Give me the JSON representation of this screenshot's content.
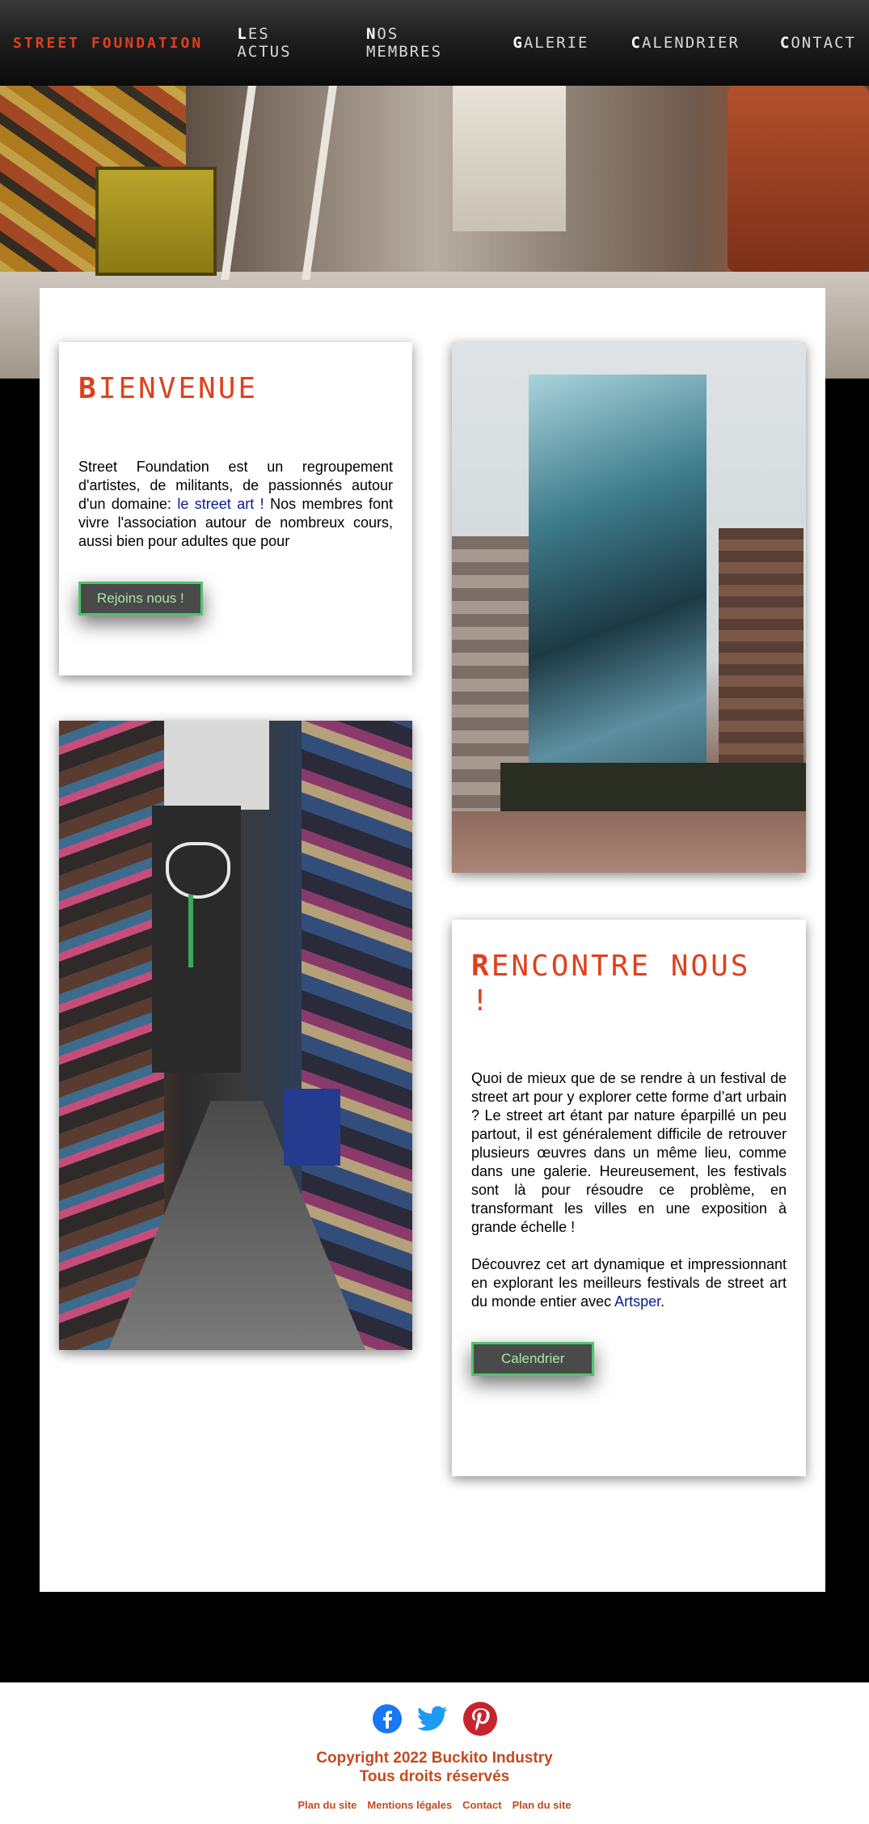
{
  "nav": {
    "brand": "STREET FOUNDATION",
    "links": [
      "LES ACTUS",
      "NOS MEMBRES",
      "GALERIE",
      "CALENDRIER",
      "CONTACT"
    ]
  },
  "welcome": {
    "title": "BIENVENUE",
    "text_before": "Street Foundation est un regroupement d'artistes, de militants, de passionnés autour d'un domaine: ",
    "link": "le street art !",
    "text_after": " Nos membres font vivre l'association autour de nombreux cours, aussi bien pour adultes que pour",
    "button": "Rejoins nous !"
  },
  "meet": {
    "title": "RENCONTRE NOUS !",
    "paragraph1": "Quoi de mieux que de se rendre à un festival de street art pour y explorer cette forme d’art urbain ? Le street art étant par nature éparpillé un peu partout, il est généralement difficile de retrouver plusieurs œuvres dans un même lieu, comme dans une galerie. Heureusement, les festivals sont là pour résoudre ce problème, en transformant les villes en une exposition à grande échelle !",
    "paragraph2_before": "Découvrez cet art dynamique et impressionnant en explorant les meilleurs festivals de street art du monde entier avec ",
    "paragraph2_link": "Artsper",
    "paragraph2_after": ".",
    "button": "Calendrier"
  },
  "footer": {
    "social": [
      "facebook-icon",
      "twitter-icon",
      "pinterest-icon"
    ],
    "copyright": "Copyright 2022 Buckito Industry",
    "rights": "Tous droits réservés",
    "links": [
      "Plan du site",
      "Mentions légales",
      "Contact",
      "Plan du site"
    ]
  },
  "colors": {
    "accent": "#e0401c",
    "footer_text": "#c24b20",
    "button_bg": "#4a4a4a",
    "button_border": "#4fc56a",
    "link": "#0a1a8f"
  }
}
